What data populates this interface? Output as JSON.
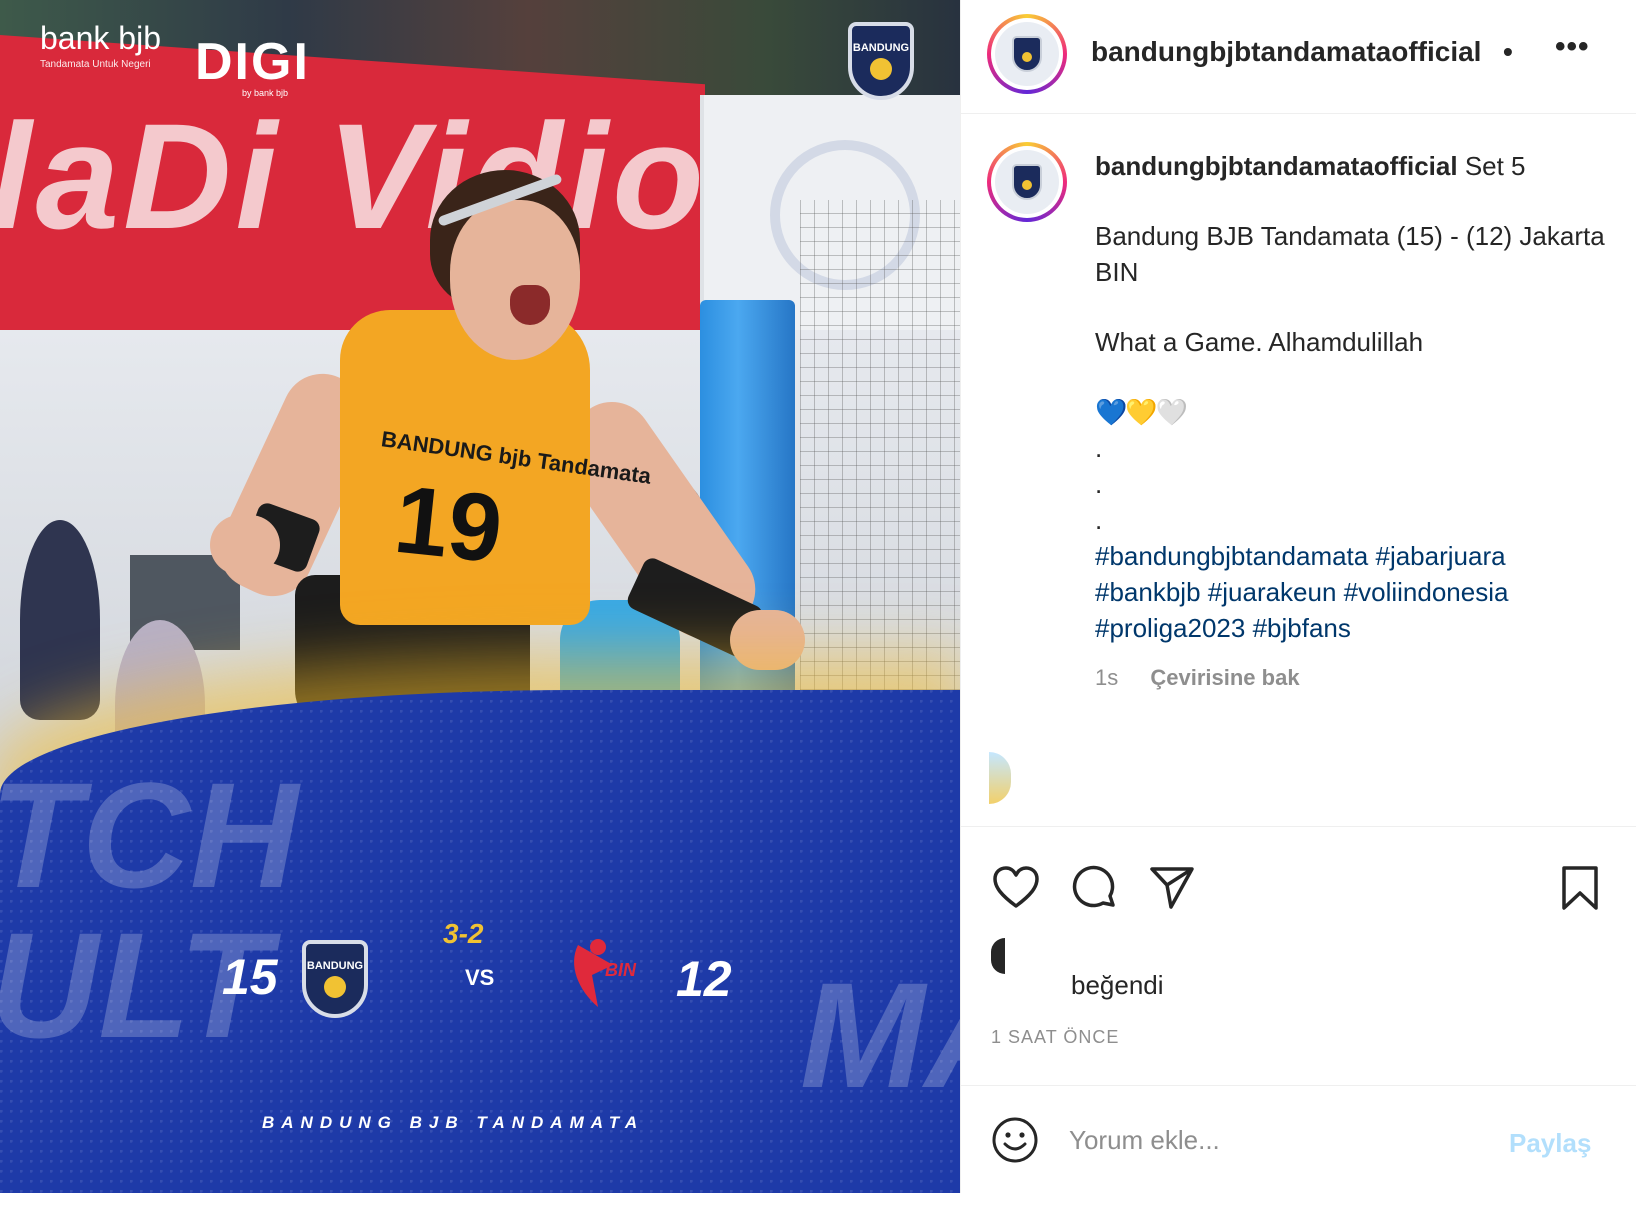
{
  "post_image": {
    "sponsor_bank": "bank bjb",
    "sponsor_bank_tagline": "Tandamata Untuk Negeri",
    "sponsor_digi": "DIGI",
    "sponsor_digi_tagline": "by bank bjb",
    "banner_text": "laDi Vidio",
    "team_crest_text": "BANDUNG",
    "jersey_name": "BANDUNG bjb Tandamata",
    "jersey_number": "19",
    "home_score": "15",
    "set_score": "3-2",
    "vs_label": "VS",
    "away_score": "12",
    "away_logo_text": "BIN",
    "footer_team": "BANDUNG BJB TANDAMATA",
    "bg_word_left": "TCH ULT",
    "bg_word_right": "MAT"
  },
  "header": {
    "username": "bandungbjbtandamataofficial",
    "dot": "•",
    "more": "•••"
  },
  "caption": {
    "username": "bandungbjbtandamataofficial",
    "line1": "Set 5",
    "line2": "Bandung BJB Tandamata (15) - (12) Jakarta BIN",
    "line3": "What a Game. Alhamdulillah",
    "hearts": "💙💛🤍",
    "dot1": ".",
    "dot2": ".",
    "dot3": ".",
    "hashtags": [
      "#bandungbjbtandamata",
      "#jabarjuara",
      "#bankbjb",
      "#juarakeun",
      "#voliindonesia",
      "#proliga2023",
      "#bjbfans"
    ]
  },
  "meta": {
    "time": "1s",
    "translate": "Çevirisine bak"
  },
  "actions": {
    "like_icon": "heart-icon",
    "comment_icon": "comment-icon",
    "share_icon": "send-icon",
    "save_icon": "bookmark-icon"
  },
  "likes": {
    "text": "beğendi"
  },
  "timestamp": "1 SAAT ÖNCE",
  "comment": {
    "placeholder": "Yorum ekle...",
    "post_label": "Paylaş"
  },
  "colors": {
    "hashtag": "#00376b",
    "post_button_disabled": "#b2dffc",
    "muted": "#8e8e8e",
    "court_blue": "#1e3aa8",
    "jersey_yellow": "#f3a623"
  }
}
